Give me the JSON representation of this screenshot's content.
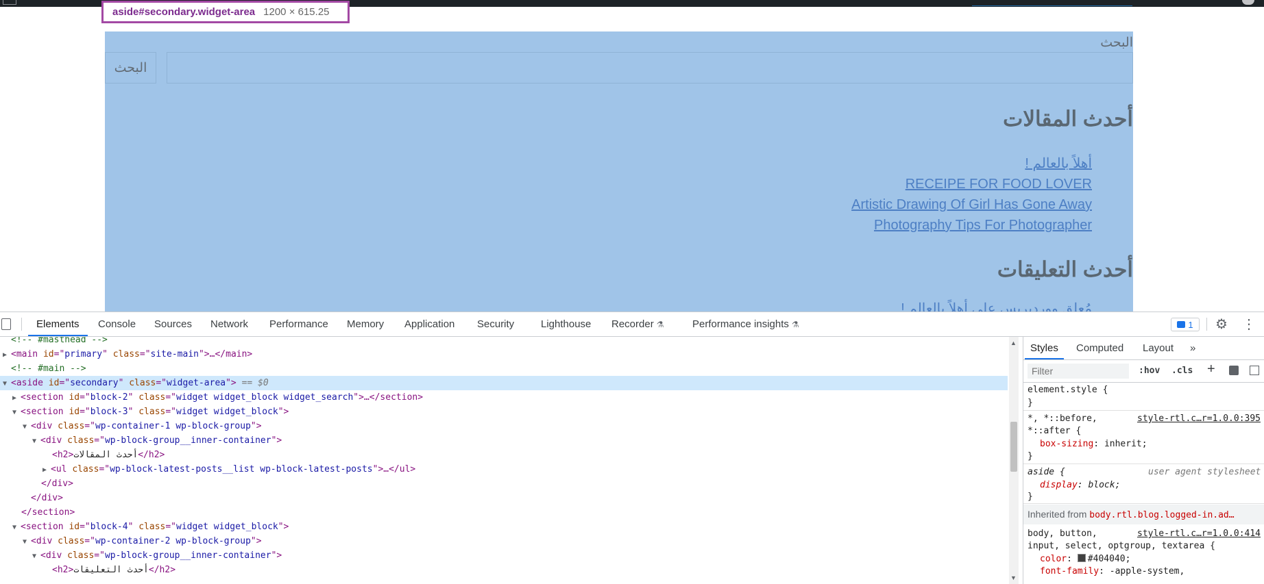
{
  "tooltip": {
    "selector": "aside#secondary.widget-area",
    "dimensions": "1200 × 615.25"
  },
  "widget": {
    "search_label": "البحث",
    "search_button": "البحث",
    "latest_posts_heading": "أحدث المقالات",
    "posts": [
      "أهلاً بالعالم !",
      "RECEIPE FOR FOOD LOVER",
      "Artistic Drawing Of Girl Has Gone Away",
      "Photography Tips For Photographer"
    ],
    "latest_comments_heading": "أحدث التعليقات",
    "comment_peek": "مُعلق ووردبريس على أهلاً بالعالم !"
  },
  "devtools": {
    "tabs": [
      "Elements",
      "Console",
      "Sources",
      "Network",
      "Performance",
      "Memory",
      "Application",
      "Security",
      "Lighthouse",
      "Recorder",
      "Performance insights"
    ],
    "active_tab": "Elements",
    "issues_count": "1",
    "dom": {
      "l0": "<!-- #masthead -->",
      "l1_tag": "main",
      "l1_id": "primary",
      "l1_class": "site-main",
      "l1_rest": "…</main>",
      "l2": "<!-- #main -->",
      "l3_tag": "aside",
      "l3_id": "secondary",
      "l3_class": "widget-area",
      "l3_eq": "== $0",
      "l4_tag": "section",
      "l4_id": "block-2",
      "l4_class": "widget widget_block widget_search",
      "l4_rest": "…</section>",
      "l5_tag": "section",
      "l5_id": "block-3",
      "l5_class": "widget widget_block",
      "l6_tag": "div",
      "l6_class": "wp-container-1 wp-block-group",
      "l7_tag": "div",
      "l7_class": "wp-block-group__inner-container",
      "l8_open": "<h2>",
      "l8_text": "أحدث المقالات",
      "l8_close": "</h2>",
      "l9_tag": "ul",
      "l9_class": "wp-block-latest-posts__list wp-block-latest-posts",
      "l9_rest": "…</ul>",
      "l10": "</div>",
      "l11": "</div>",
      "l12": "</section>",
      "l13_tag": "section",
      "l13_id": "block-4",
      "l13_class": "widget widget_block",
      "l14_tag": "div",
      "l14_class": "wp-container-2 wp-block-group",
      "l15_tag": "div",
      "l15_class": "wp-block-group__inner-container",
      "l16_open": "<h2>",
      "l16_text": "أحدث التعليقات",
      "l16_close": "</h2>"
    },
    "styles": {
      "tabs": [
        "Styles",
        "Computed",
        "Layout"
      ],
      "more": "»",
      "filter_placeholder": "Filter",
      "hov": ":hov",
      "cls": ".cls",
      "r1_sel": "element.style {",
      "r1_close": "}",
      "r2_sel_a": "*, *::before,",
      "r2_src": "style-rtl.c…r=1.0.0:395",
      "r2_sel_b": "*::after {",
      "r2_prop": "box-sizing",
      "r2_val": "inherit;",
      "r2_close": "}",
      "r3_sel": "aside {",
      "r3_src": "user agent stylesheet",
      "r3_prop": "display",
      "r3_val": "block;",
      "r3_close": "}",
      "inherited_label": "Inherited from",
      "inherited_sel": "body.rtl.blog.logged-in.ad…",
      "r4_sel_a": "body, button,",
      "r4_src": "style-rtl.c…r=1.0.0:414",
      "r4_sel_b": "input, select, optgroup, textarea {",
      "r4_prop": "color",
      "r4_val": "#404040;",
      "r4_prop2": "font-family",
      "r4_val2": "-apple-system,"
    }
  },
  "colors": {
    "highlight": "#a0c4e8",
    "tooltip_border": "#a349a4",
    "accent": "#1a73e8"
  }
}
